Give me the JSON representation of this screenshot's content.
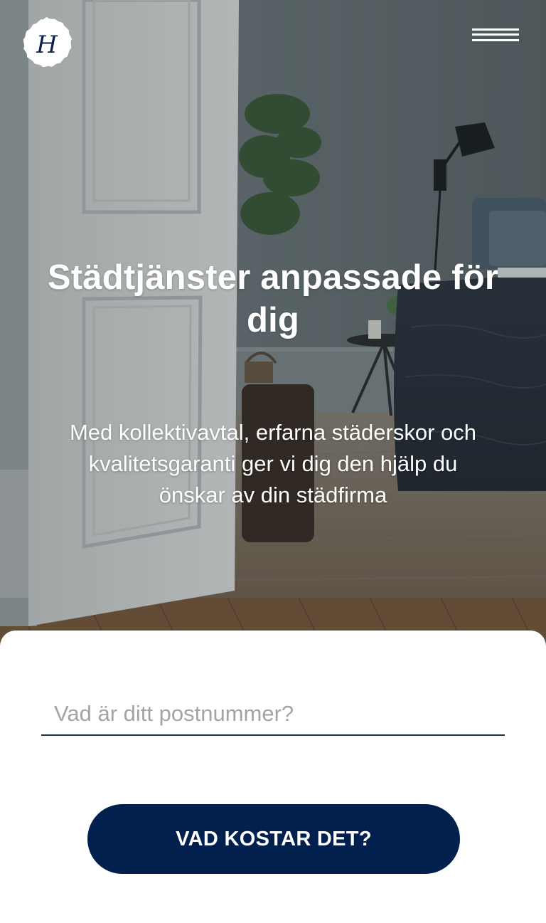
{
  "header": {
    "logo_letter": "H",
    "logo_icon": "logo-monogram-icon",
    "menu_icon": "hamburger-menu-icon"
  },
  "hero": {
    "title": "Städtjänster anpassade för dig",
    "subtitle": "Med kollektivavtal, erfarna städerskor och kvalitetsgaranti ger vi dig den hjälp du önskar av din städfirma"
  },
  "form": {
    "postcode_placeholder": "Vad är ditt postnummer?",
    "postcode_value": "",
    "cta_label": "VAD KOSTAR DET?"
  },
  "colors": {
    "brand_navy": "#01204e",
    "input_underline": "#1c2b4a",
    "placeholder": "#a4a4a4",
    "hero_text": "#ffffff"
  }
}
